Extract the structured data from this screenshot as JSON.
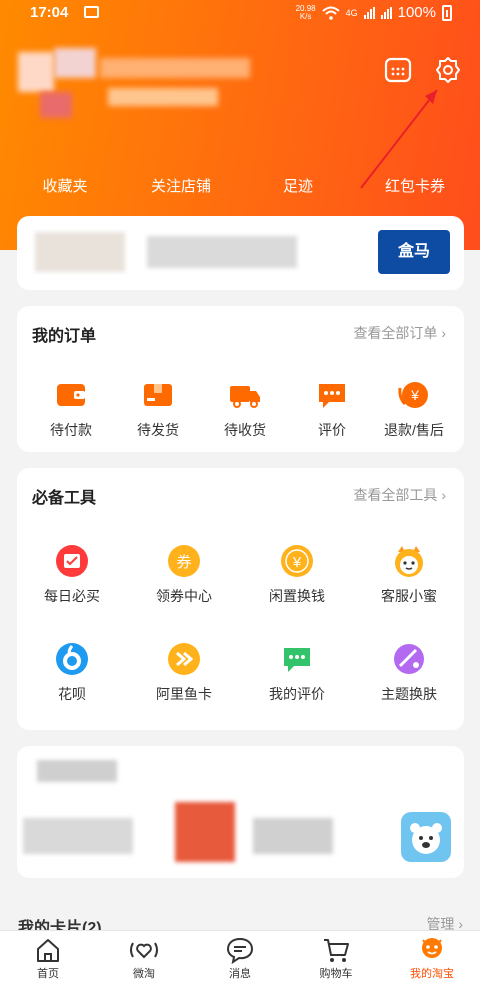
{
  "status": {
    "time": "17:04",
    "speed_value": "20.98",
    "speed_unit": "K/s",
    "network": "4G",
    "battery": "100%"
  },
  "header": {
    "quick_links": [
      "收藏夹",
      "关注店铺",
      "足迹",
      "红包卡券"
    ]
  },
  "orders": {
    "title": "我的订单",
    "more": "查看全部订单",
    "items": [
      {
        "label": "待付款",
        "icon": "wallet-icon"
      },
      {
        "label": "待发货",
        "icon": "package-icon"
      },
      {
        "label": "待收货",
        "icon": "truck-icon"
      },
      {
        "label": "评价",
        "icon": "comment-icon"
      },
      {
        "label": "退款/售后",
        "icon": "refund-icon"
      }
    ]
  },
  "tools": {
    "title": "必备工具",
    "more": "查看全部工具",
    "items": [
      {
        "label": "每日必买",
        "icon": "calendar-check-icon"
      },
      {
        "label": "领券中心",
        "icon": "coupon-icon"
      },
      {
        "label": "闲置换钱",
        "icon": "yen-coin-icon"
      },
      {
        "label": "客服小蜜",
        "icon": "assistant-icon"
      },
      {
        "label": "花呗",
        "icon": "huabei-icon"
      },
      {
        "label": "阿里鱼卡",
        "icon": "play-card-icon"
      },
      {
        "label": "我的评价",
        "icon": "chat-bubble-icon"
      },
      {
        "label": "主题换肤",
        "icon": "palette-icon"
      }
    ]
  },
  "promo_card": {
    "badge": "盒马"
  },
  "my_cards": {
    "title": "我的卡片(2)",
    "manage": "管理"
  },
  "bottom_nav": [
    {
      "label": "首页",
      "icon": "home-icon"
    },
    {
      "label": "微淘",
      "icon": "heart-signal-icon"
    },
    {
      "label": "消息",
      "icon": "message-icon"
    },
    {
      "label": "购物车",
      "icon": "cart-icon"
    },
    {
      "label": "我的淘宝",
      "icon": "my-taobao-icon"
    }
  ],
  "colors": {
    "accent": "#ff5000",
    "header_start": "#ff8a00",
    "header_end": "#ff4d1c",
    "icon_orange": "#ff6a00"
  }
}
